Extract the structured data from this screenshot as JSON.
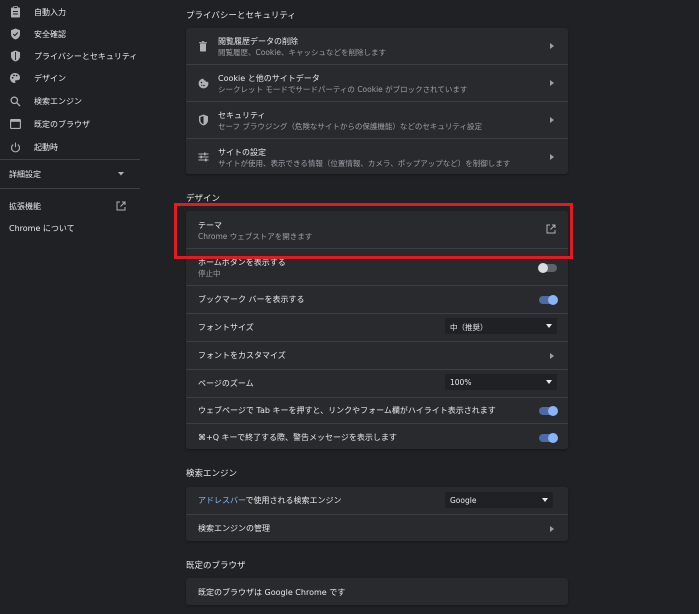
{
  "sidebar": {
    "items": [
      {
        "label": "自動入力",
        "icon": "clipboard-icon"
      },
      {
        "label": "安全確認",
        "icon": "shield-check-icon"
      },
      {
        "label": "プライバシーとセキュリティ",
        "icon": "shield-icon"
      },
      {
        "label": "デザイン",
        "icon": "palette-icon"
      },
      {
        "label": "検索エンジン",
        "icon": "search-icon"
      },
      {
        "label": "既定のブラウザ",
        "icon": "browser-icon"
      },
      {
        "label": "起動時",
        "icon": "power-icon"
      }
    ],
    "advanced_label": "詳細設定",
    "extensions_label": "拡張機能",
    "about_label": "Chrome について"
  },
  "privacy": {
    "title": "プライバシーとセキュリティ",
    "rows": [
      {
        "title": "閲覧履歴データの削除",
        "subtitle": "閲覧履歴、Cookie、キャッシュなどを削除します",
        "icon": "trash-icon"
      },
      {
        "title": "Cookie と他のサイトデータ",
        "subtitle": "シークレット モードでサードパーティの Cookie がブロックされています",
        "icon": "cookie-icon"
      },
      {
        "title": "セキュリティ",
        "subtitle": "セーフ ブラウジング（危険なサイトからの保護機能）などのセキュリティ設定",
        "icon": "security-shield-icon"
      },
      {
        "title": "サイトの設定",
        "subtitle": "サイトが使用、表示できる情報（位置情報、カメラ、ポップアップなど）を制御します",
        "icon": "sliders-icon"
      }
    ]
  },
  "design": {
    "title": "デザイン",
    "theme_title": "テーマ",
    "theme_subtitle": "Chrome ウェブストアを開きます",
    "home_title": "ホームボタンを表示する",
    "home_subtitle": "停止中",
    "home_on": false,
    "bookmarks_title": "ブックマーク バーを表示する",
    "bookmarks_on": true,
    "font_size_label": "フォントサイズ",
    "font_size_value": "中（推奨）",
    "customize_fonts_label": "フォントをカスタマイズ",
    "zoom_label": "ページのズーム",
    "zoom_value": "100%",
    "tab_highlight_label": "ウェブページで Tab キーを押すと、リンクやフォーム欄がハイライト表示されます",
    "tab_highlight_on": true,
    "quit_warning_label": "⌘+Q キーで終了する際、警告メッセージを表示します",
    "quit_warning_on": true
  },
  "search": {
    "title": "検索エンジン",
    "engine_link": "アドレスバー",
    "engine_label_rest": "で使用される検索エンジン",
    "engine_value": "Google",
    "manage_label": "検索エンジンの管理"
  },
  "default_browser": {
    "title": "既定のブラウザ",
    "status": "既定のブラウザは Google Chrome です"
  },
  "colors": {
    "accent": "#8ab4f8",
    "highlight": "#e01b24",
    "background": "#202124",
    "card": "#292a2d"
  }
}
